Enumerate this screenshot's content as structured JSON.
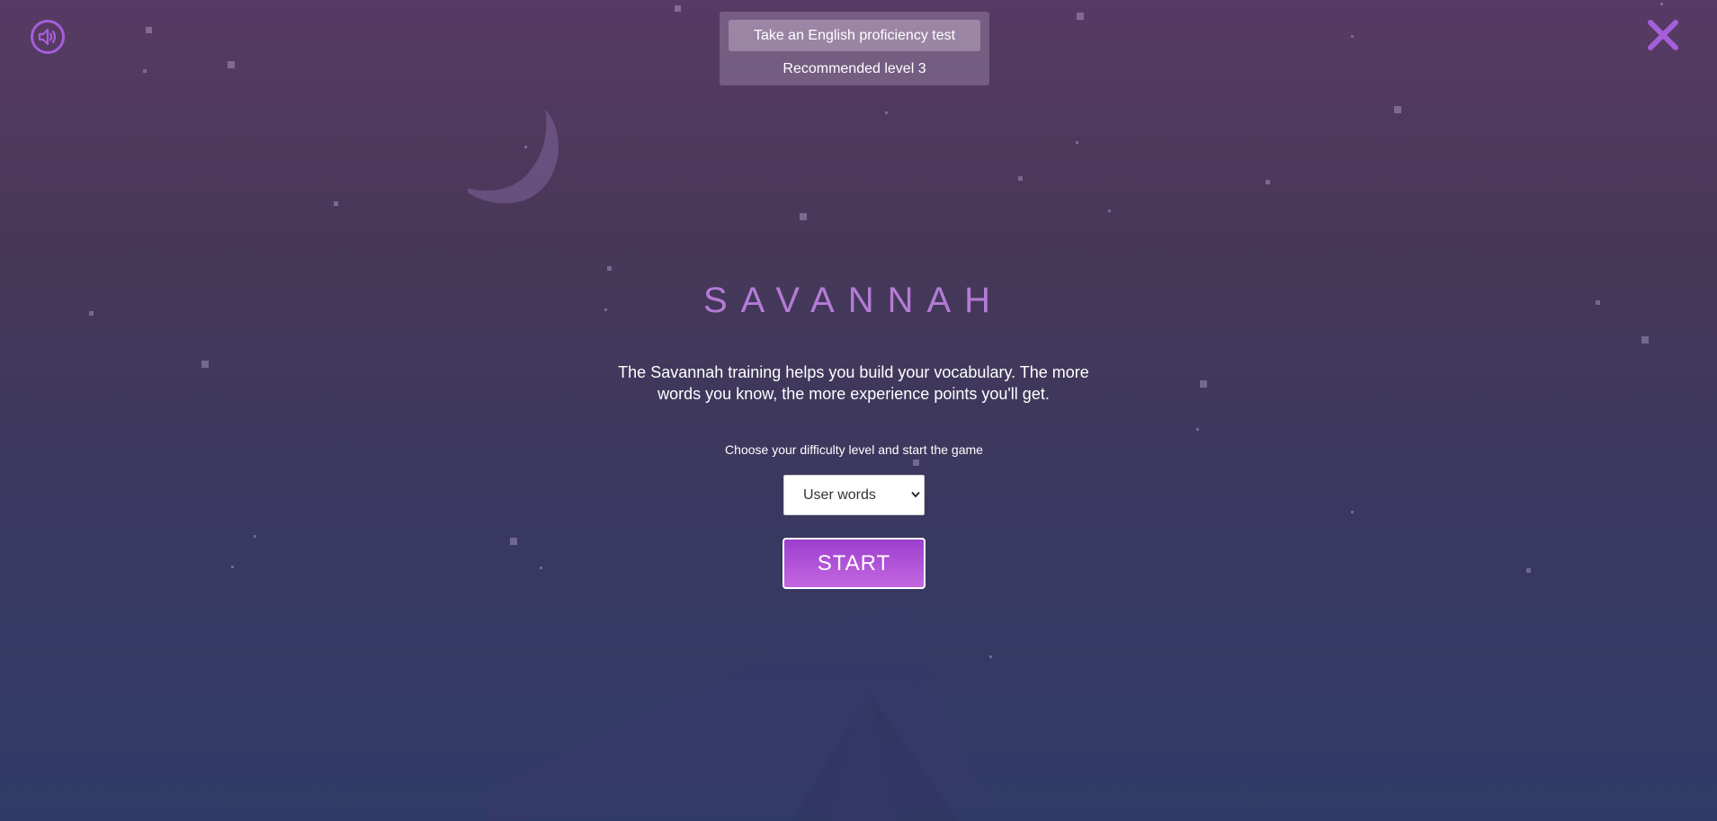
{
  "app": {
    "accent_color": "#a55fd9",
    "title_color": "#b47bd6",
    "start_gradient": [
      "#9c3ecf",
      "#c467df"
    ]
  },
  "controls": {
    "sound_icon": "speaker-volume-icon",
    "close_icon": "close-x-icon"
  },
  "proficiency": {
    "test_button_label": "Take an English proficiency test",
    "recommended_label": "Recommended level 3"
  },
  "game": {
    "title": "SAVANNAH",
    "description": "The Savannah training helps you build your vocabulary. The more words you know, the more experience points you'll get.",
    "choose_label": "Choose your difficulty level and start the game",
    "difficulty_selected": "User words",
    "start_label": "START"
  }
}
